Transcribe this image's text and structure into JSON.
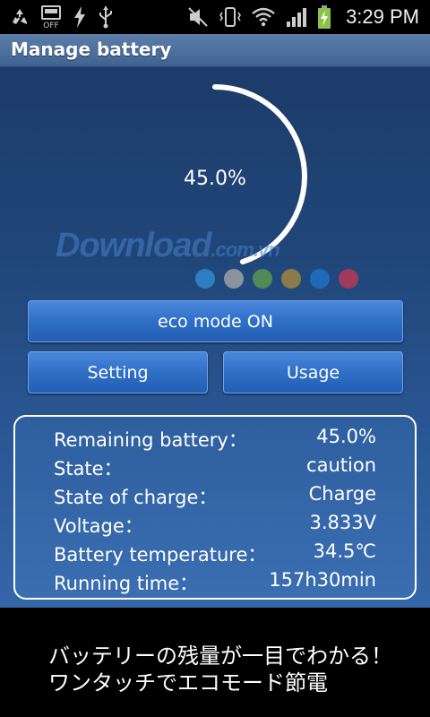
{
  "status_bar": {
    "time": "3:29 PM",
    "icons": [
      "recycle-icon",
      "sd-off-icon",
      "lightning-icon",
      "usb-icon",
      "mute-icon",
      "vibrate-icon",
      "wifi-icon",
      "signal-icon",
      "battery-charging-icon"
    ],
    "off_label": "OFF"
  },
  "app_bar": {
    "title": "Manage battery"
  },
  "gauge": {
    "value_text": "45.0%",
    "level": 0.45,
    "arc_color": "#ffffff",
    "dot_colors": [
      "#2f7ec2",
      "#8b939c",
      "#4f8b55",
      "#8c7a4a",
      "#1f6ab8",
      "#a03b5c"
    ]
  },
  "watermark": {
    "text": "Download",
    "suffix": ".com.vn"
  },
  "buttons": {
    "eco": "eco mode ON",
    "setting": "Setting",
    "usage": "Usage"
  },
  "info": [
    {
      "label": "Remaining battery：",
      "value": "45.0%"
    },
    {
      "label": "State：",
      "value": "caution"
    },
    {
      "label": "State of charge：",
      "value": "Charge"
    },
    {
      "label": "Voltage：",
      "value": "3.833V"
    },
    {
      "label": "Battery temperature：",
      "value": "34.5℃"
    },
    {
      "label": "Running time：",
      "value": "157h30min"
    }
  ],
  "banner": {
    "line1": "バッテリーの残量が一目でわかる！",
    "line2": "ワンタッチでエコモード節電"
  },
  "colors": {
    "accent": "#2f6fc6",
    "title_bar": "#4a6f9e"
  }
}
